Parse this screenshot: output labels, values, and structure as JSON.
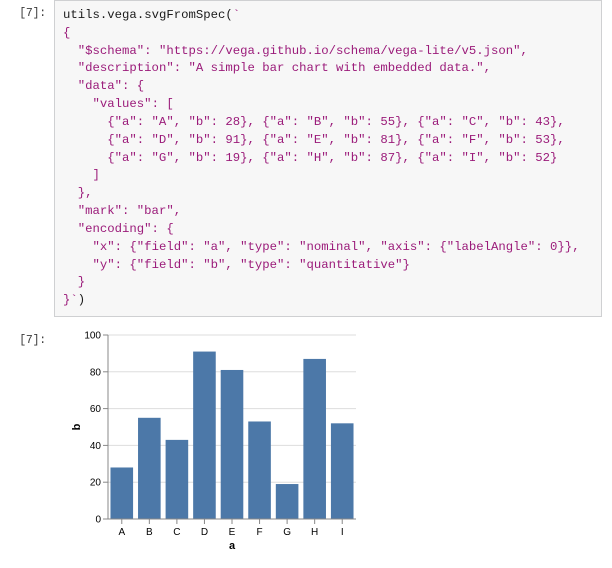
{
  "input_prompt": "[7]:",
  "output_prompt": "[7]:",
  "code": {
    "p": "utils",
    "d1": ".",
    "p2": "vega",
    "d2": ".",
    "p3": "svgFromSpec",
    "open_paren": "(",
    "backtick": "`",
    "body": "\n{\n  \"$schema\": \"https://vega.github.io/schema/vega-lite/v5.json\",\n  \"description\": \"A simple bar chart with embedded data.\",\n  \"data\": {\n    \"values\": [\n      {\"a\": \"A\", \"b\": 28}, {\"a\": \"B\", \"b\": 55}, {\"a\": \"C\", \"b\": 43},\n      {\"a\": \"D\", \"b\": 91}, {\"a\": \"E\", \"b\": 81}, {\"a\": \"F\", \"b\": 53},\n      {\"a\": \"G\", \"b\": 19}, {\"a\": \"H\", \"b\": 87}, {\"a\": \"I\", \"b\": 52}\n    ]\n  },\n  \"mark\": \"bar\",\n  \"encoding\": {\n    \"x\": {\"field\": \"a\", \"type\": \"nominal\", \"axis\": {\"labelAngle\": 0}},\n    \"y\": {\"field\": \"b\", \"type\": \"quantitative\"}\n  }\n}",
    "end_backtick": "`",
    "close_paren": ")"
  },
  "chart_data": {
    "type": "bar",
    "categories": [
      "A",
      "B",
      "C",
      "D",
      "E",
      "F",
      "G",
      "H",
      "I"
    ],
    "values": [
      28,
      55,
      43,
      91,
      81,
      53,
      19,
      87,
      52
    ],
    "xlabel": "a",
    "ylabel": "b",
    "ylim": [
      0,
      100
    ],
    "yticks": [
      0,
      20,
      40,
      60,
      80,
      100
    ],
    "bar_color": "#4c78a8"
  }
}
